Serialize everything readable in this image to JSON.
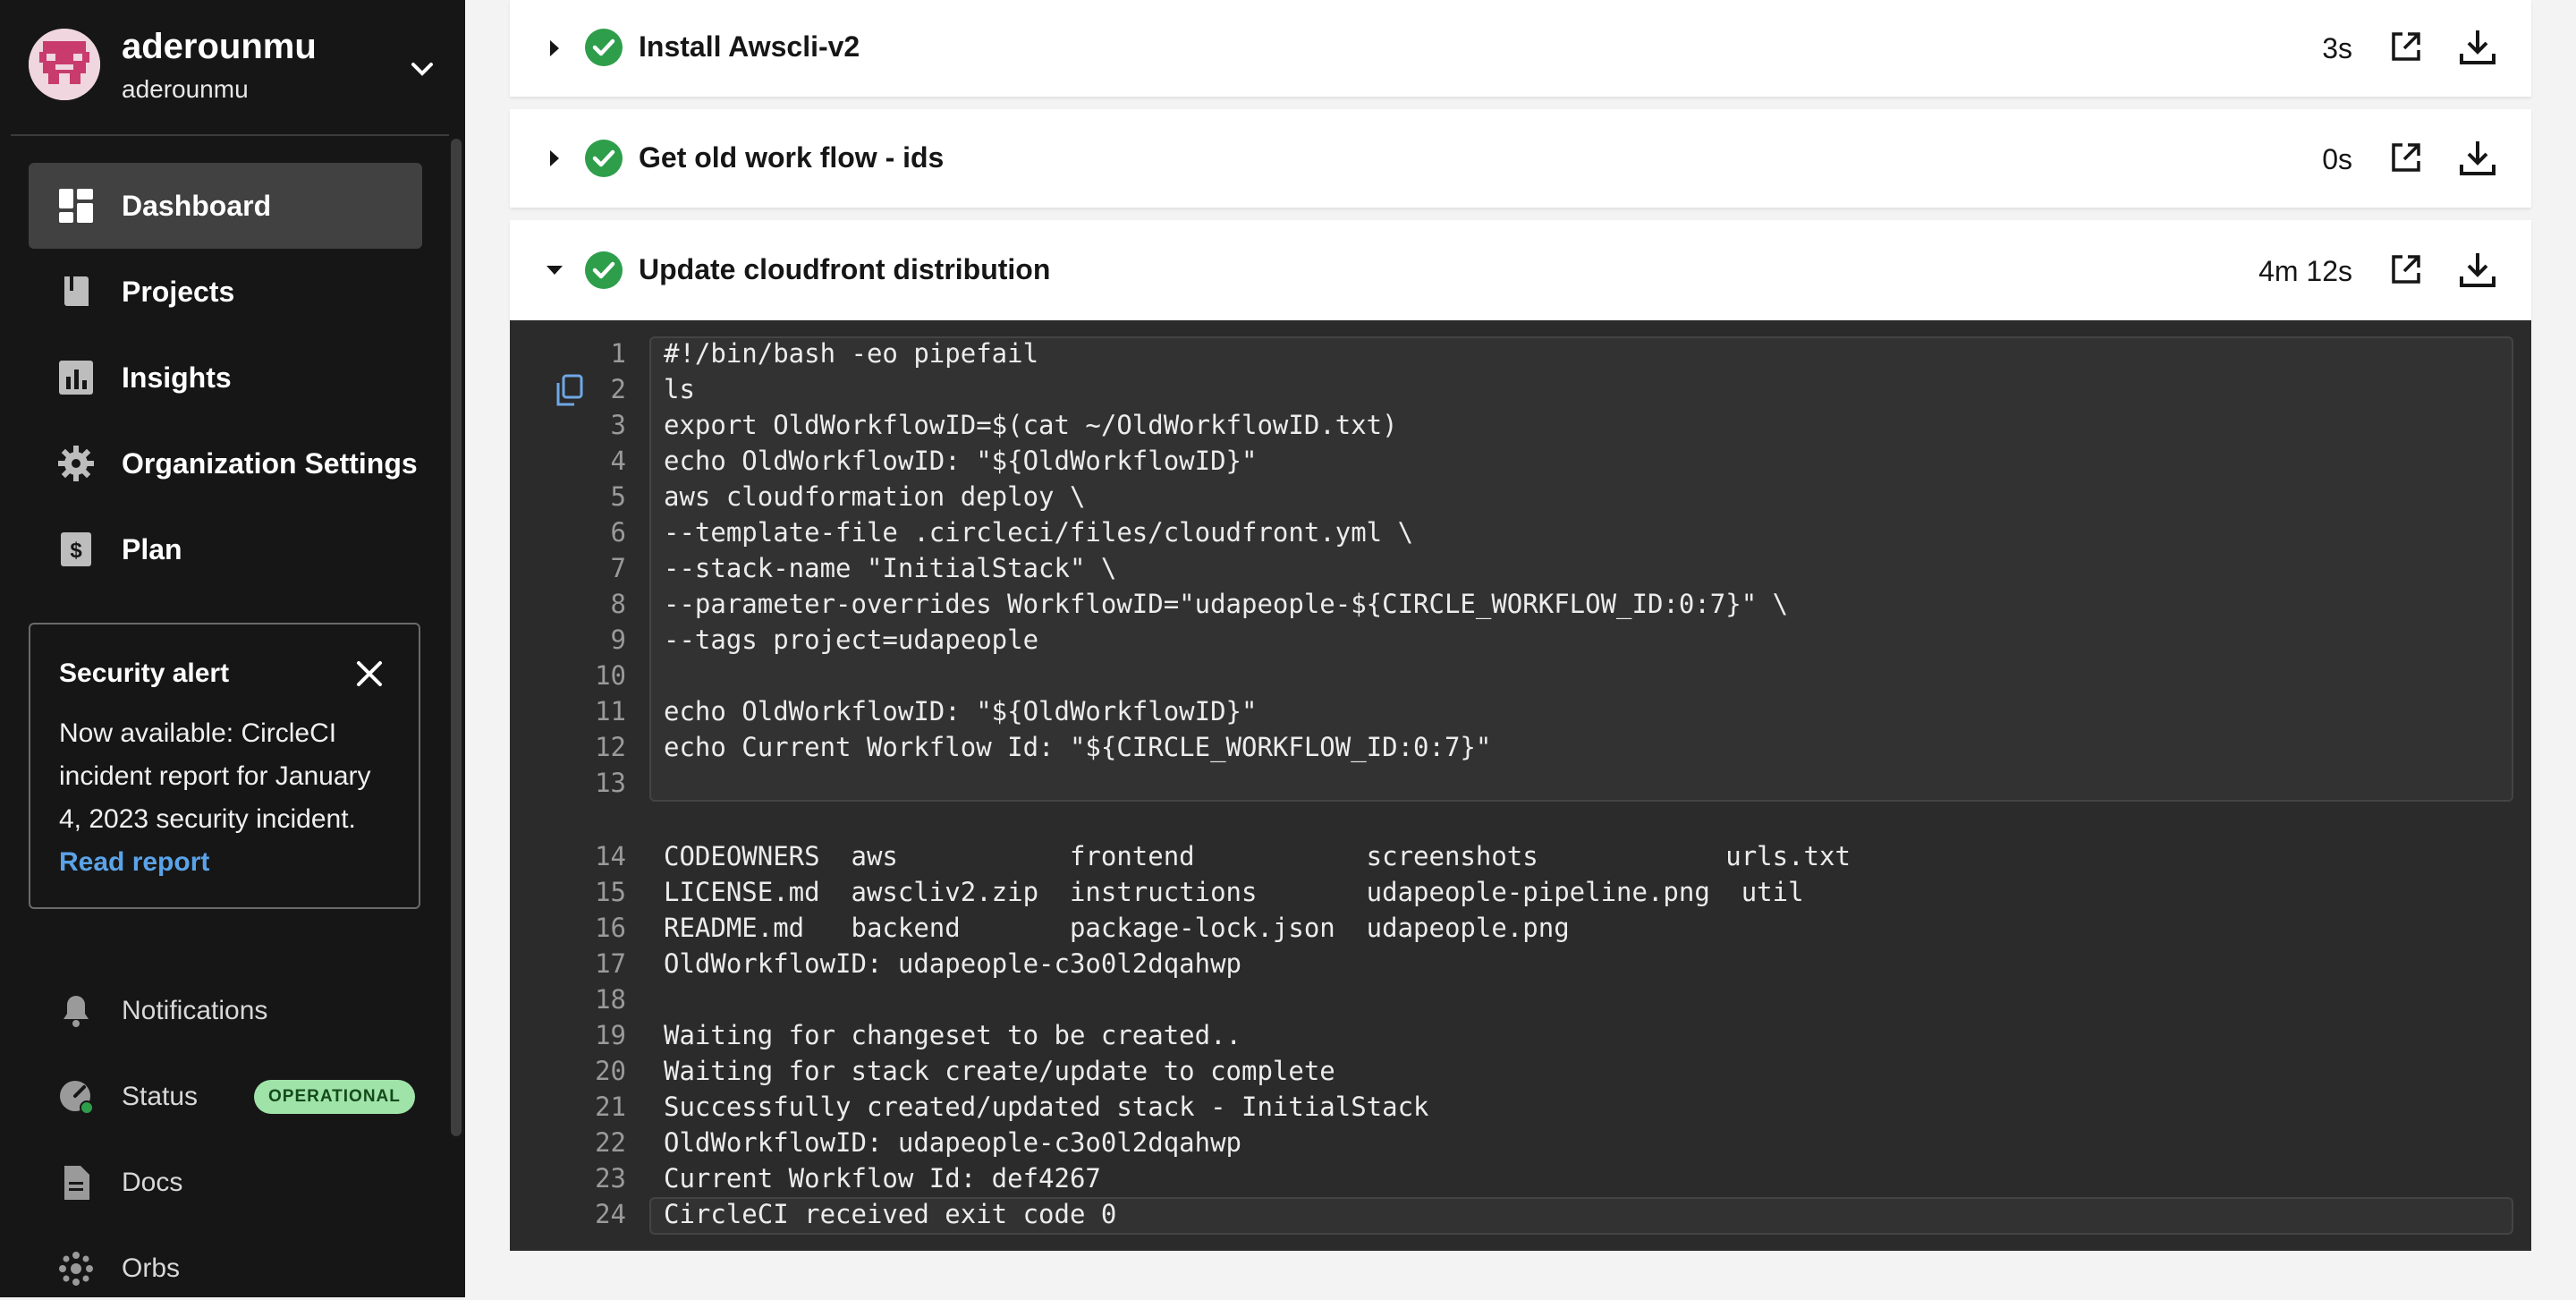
{
  "user": {
    "name": "aderounmu",
    "org": "aderounmu"
  },
  "nav": [
    {
      "label": "Dashboard",
      "icon": "dashboard-icon"
    },
    {
      "label": "Projects",
      "icon": "book-icon"
    },
    {
      "label": "Insights",
      "icon": "bar-chart-icon"
    },
    {
      "label": "Organization Settings",
      "icon": "gear-icon"
    },
    {
      "label": "Plan",
      "icon": "dollar-icon"
    }
  ],
  "alert": {
    "title": "Security alert",
    "body": "Now available: CircleCI incident report for January 4, 2023 security incident.",
    "link": "Read report"
  },
  "bottom_nav": [
    {
      "label": "Notifications",
      "icon": "bell-icon"
    },
    {
      "label": "Status",
      "icon": "status-gauge-icon",
      "badge": "OPERATIONAL"
    },
    {
      "label": "Docs",
      "icon": "document-icon"
    },
    {
      "label": "Orbs",
      "icon": "orbs-icon"
    }
  ],
  "steps": [
    {
      "title": "Install Awscli-v2",
      "time": "3s",
      "expanded": false
    },
    {
      "title": "Get old work flow - ids",
      "time": "0s",
      "expanded": false
    },
    {
      "title": "Update cloudfront distribution",
      "time": "4m 12s",
      "expanded": true
    }
  ],
  "log_lines": [
    {
      "n": "1",
      "t": "#!/bin/bash -eo pipefail"
    },
    {
      "n": "2",
      "t": "ls"
    },
    {
      "n": "3",
      "t": "export OldWorkflowID=$(cat ~/OldWorkflowID.txt)"
    },
    {
      "n": "4",
      "t": "echo OldWorkflowID: \"${OldWorkflowID}\""
    },
    {
      "n": "5",
      "t": "aws cloudformation deploy \\"
    },
    {
      "n": "6",
      "t": "--template-file .circleci/files/cloudfront.yml \\"
    },
    {
      "n": "7",
      "t": "--stack-name \"InitialStack\" \\"
    },
    {
      "n": "8",
      "t": "--parameter-overrides WorkflowID=\"udapeople-${CIRCLE_WORKFLOW_ID:0:7}\" \\"
    },
    {
      "n": "9",
      "t": "--tags project=udapeople"
    },
    {
      "n": "10",
      "t": ""
    },
    {
      "n": "11",
      "t": "echo OldWorkflowID: \"${OldWorkflowID}\""
    },
    {
      "n": "12",
      "t": "echo Current Workflow Id: \"${CIRCLE_WORKFLOW_ID:0:7}\""
    },
    {
      "n": "13",
      "t": ""
    },
    {
      "n": "14",
      "t": "CODEOWNERS  aws           frontend           screenshots            urls.txt"
    },
    {
      "n": "15",
      "t": "LICENSE.md  awscliv2.zip  instructions       udapeople-pipeline.png  util"
    },
    {
      "n": "16",
      "t": "README.md   backend       package-lock.json  udapeople.png"
    },
    {
      "n": "17",
      "t": "OldWorkflowID: udapeople-c3o0l2dqahwp"
    },
    {
      "n": "18",
      "t": ""
    },
    {
      "n": "19",
      "t": "Waiting for changeset to be created.."
    },
    {
      "n": "20",
      "t": "Waiting for stack create/update to complete"
    },
    {
      "n": "21",
      "t": "Successfully created/updated stack - InitialStack"
    },
    {
      "n": "22",
      "t": "OldWorkflowID: udapeople-c3o0l2dqahwp"
    },
    {
      "n": "23",
      "t": "Current Workflow Id: def4267"
    },
    {
      "n": "24",
      "t": "CircleCI received exit code 0"
    }
  ],
  "colors": {
    "sidebar_bg": "#161616",
    "success": "#2e9e4b",
    "badge_bg": "#9fe3a8",
    "link": "#5aa3e8",
    "terminal_bg": "#2b2b2b"
  }
}
